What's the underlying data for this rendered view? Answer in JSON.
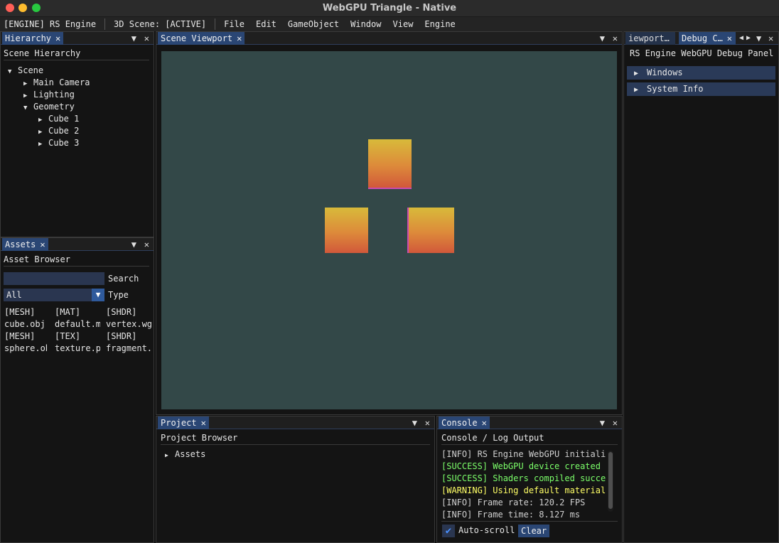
{
  "window": {
    "title": "WebGPU Triangle - Native"
  },
  "menubar": {
    "engine_label": "[ENGINE] RS Engine",
    "scene_label": "3D Scene: [ACTIVE]",
    "menus": [
      "File",
      "Edit",
      "GameObject",
      "Window",
      "View",
      "Engine"
    ]
  },
  "hierarchy": {
    "tab": "Hierarchy",
    "title": "Scene Hierarchy",
    "items": [
      "Scene",
      "Main Camera",
      "Lighting",
      "Geometry",
      "Cube 1",
      "Cube 2",
      "Cube 3"
    ]
  },
  "assets": {
    "tab": "Assets",
    "title": "Asset Browser",
    "search_value": "",
    "search_label": "Search",
    "type_value": "All",
    "type_label": "Type",
    "grid": [
      [
        "[MESH]",
        "[MAT]",
        "[SHDR]"
      ],
      [
        "cube.obj",
        "default.m",
        "vertex.wg"
      ],
      [
        "[MESH]",
        "[TEX]",
        "[SHDR]"
      ],
      [
        "sphere.ob",
        "texture.p",
        "fragment."
      ]
    ]
  },
  "viewport": {
    "tab": "Scene Viewport"
  },
  "right_panel": {
    "tab_inactive": "iewport…",
    "tab_active": "Debug C…",
    "title": "RS Engine WebGPU Debug Panel",
    "sections": [
      "Windows",
      "System Info"
    ]
  },
  "project": {
    "tab": "Project",
    "title": "Project Browser",
    "items": [
      "Assets"
    ]
  },
  "console": {
    "tab": "Console",
    "title": "Console / Log Output",
    "lines": [
      "[INFO] RS Engine WebGPU initializ",
      "[SUCCESS] WebGPU device created",
      "[SUCCESS] Shaders compiled succes",
      "[WARNING] Using default material",
      "[INFO] Frame rate: 120.2 FPS",
      "[INFO] Frame time: 8.127 ms"
    ],
    "autoscroll_label": "Auto-scroll",
    "autoscroll_checked": true,
    "clear_label": "Clear"
  },
  "colors": {
    "info": "#cfcfcf",
    "success": "#7cff6a",
    "warning": "#ffff66",
    "accent": "#2a4674",
    "viewport_bg": "#334848"
  },
  "icons": {
    "close": "close-icon",
    "menu": "panel-menu-icon",
    "expanded": "triangle-down-icon",
    "collapsed": "triangle-right-icon"
  }
}
